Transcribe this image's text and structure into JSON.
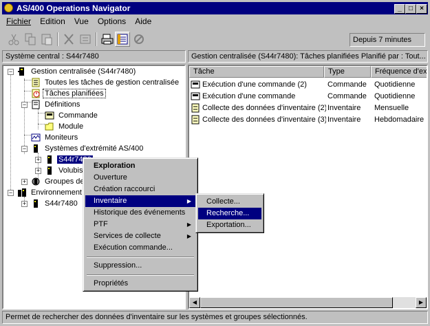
{
  "window": {
    "title": "AS/400 Operations Navigator",
    "controls": [
      "minimize-icon",
      "maximize-icon",
      "close-icon"
    ]
  },
  "menubar": {
    "items": [
      "Fichier",
      "Edition",
      "Vue",
      "Options",
      "Aide"
    ]
  },
  "toolbar": {
    "buttons": [
      "cut-icon",
      "copy-icon",
      "paste-icon",
      "delete-icon",
      "properties-icon",
      "print-icon",
      "list-view-icon",
      "stop-icon"
    ],
    "elapsed": "Depuis 7 minutes"
  },
  "left_pane": {
    "header": "Système central : S44r7480",
    "tree": [
      {
        "label": "Gestion centralisée (S44r7480)",
        "icon": "central-mgmt-icon"
      },
      {
        "label": "Toutes les tâches de gestion centralisée",
        "icon": "task-list-icon"
      },
      {
        "label": "Tâches planifiées",
        "icon": "scheduled-tasks-icon"
      },
      {
        "label": "Définitions",
        "icon": "definitions-icon"
      },
      {
        "label": "Commande",
        "icon": "command-icon"
      },
      {
        "label": "Module",
        "icon": "folder-icon"
      },
      {
        "label": "Moniteurs",
        "icon": "monitor-icon"
      },
      {
        "label": "Systèmes d'extrémité AS/400",
        "icon": "as400-icon"
      },
      {
        "label": "S44r7480",
        "icon": "as400-icon"
      },
      {
        "label": "Volubis",
        "icon": "as400-icon"
      },
      {
        "label": "Groupes de",
        "icon": "group-icon"
      },
      {
        "label": "Environnement",
        "icon": "environment-icon"
      },
      {
        "label": "S44r7480",
        "icon": "as400-icon"
      }
    ]
  },
  "right_pane": {
    "header": "Gestion centralisée (S44r7480):  Tâches planifiées    Planifié par : Tout...",
    "columns": [
      "Tâche",
      "Type",
      "Fréquence d'ex"
    ],
    "rows": [
      {
        "task": "Exécution d'une commande (2)",
        "type": "Commande",
        "freq": "Quotidienne",
        "icon": "command-task-icon"
      },
      {
        "task": "Exécution d'une commande",
        "type": "Commande",
        "freq": "Quotidienne",
        "icon": "command-task-icon"
      },
      {
        "task": "Collecte des données d'inventaire (2)",
        "type": "Inventaire",
        "freq": "Mensuelle",
        "icon": "inventory-task-icon"
      },
      {
        "task": "Collecte des données d'inventaire (3)",
        "type": "Inventaire",
        "freq": "Hebdomadaire",
        "icon": "inventory-task-icon"
      }
    ]
  },
  "context_menu": {
    "items": [
      {
        "label": "Exploration",
        "bold": true
      },
      {
        "label": "Ouverture"
      },
      {
        "label": "Création raccourci"
      },
      {
        "label": "Inventaire",
        "submenu": true,
        "selected": true
      },
      {
        "label": "Historique des événements"
      },
      {
        "label": "PTF",
        "submenu": true
      },
      {
        "label": "Services de collecte",
        "submenu": true
      },
      {
        "label": "Exécution commande..."
      },
      {
        "label": "Suppression..."
      },
      {
        "label": "Propriétés"
      }
    ]
  },
  "submenu": {
    "items": [
      {
        "label": "Collecte..."
      },
      {
        "label": "Recherche...",
        "selected": true
      },
      {
        "label": "Exportation..."
      }
    ]
  },
  "status": "Permet de rechercher des données d'inventaire sur les systèmes et groupes sélectionnés.",
  "colors": {
    "title_bar": "#000080",
    "selection": "#000080",
    "face": "#c0c0c0"
  }
}
